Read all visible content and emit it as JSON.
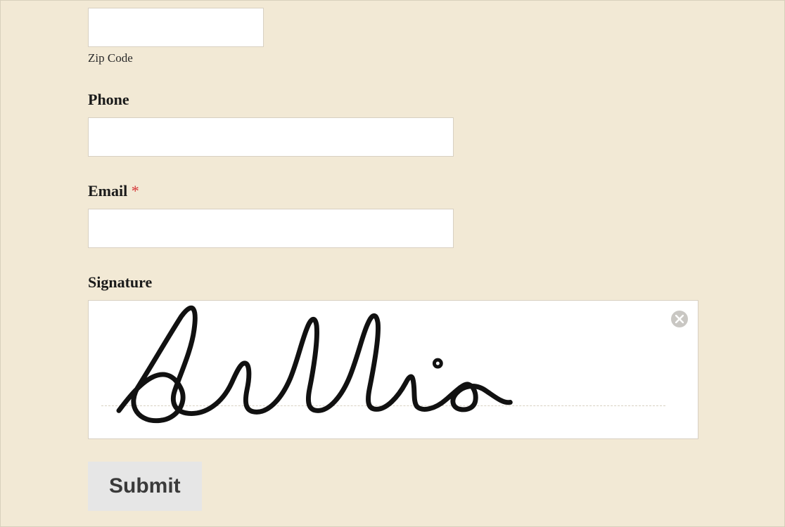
{
  "fields": {
    "zip": {
      "sublabel": "Zip Code",
      "value": ""
    },
    "phone": {
      "label": "Phone",
      "value": ""
    },
    "email": {
      "label": "Email",
      "required_mark": "*",
      "value": ""
    },
    "signature": {
      "label": "Signature",
      "display_name": "Sullie"
    }
  },
  "submit": {
    "label": "Submit"
  }
}
